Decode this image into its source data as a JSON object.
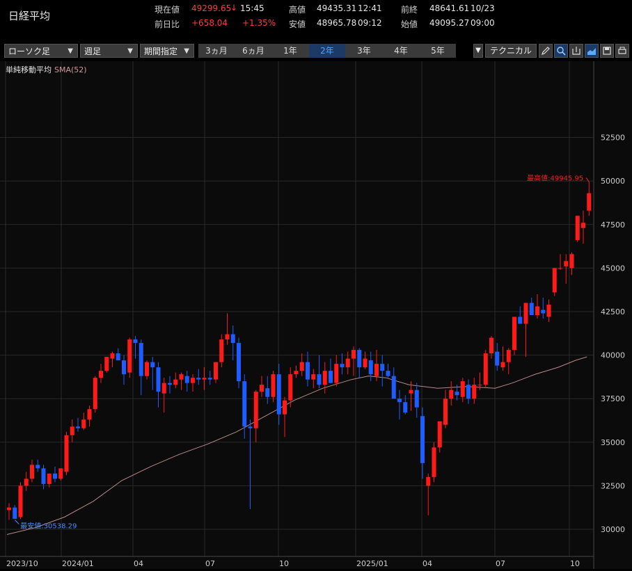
{
  "header": {
    "title": "日経平均",
    "current_label": "現在値",
    "current_value": "49299.65",
    "current_arrow": "↓",
    "current_time": "15:45",
    "change_label": "前日比",
    "change_value": "+658.04",
    "change_pct": "+1.35%",
    "high_label": "高値",
    "high_value": "49435.31",
    "high_time": "12:41",
    "low_label": "安値",
    "low_value": "48965.78",
    "low_time": "09:12",
    "prev_label": "前終",
    "prev_value": "48641.61",
    "prev_date": "10/23",
    "open_label": "始値",
    "open_value": "49095.27",
    "open_time": "09:00"
  },
  "toolbar": {
    "chart_type": "ローソク足",
    "period_type": "週足",
    "range_mode": "期間指定",
    "range_tabs": [
      "3ヵ月",
      "6ヵ月",
      "1年",
      "2年",
      "3年",
      "4年",
      "5年"
    ],
    "selected_tab": "2年",
    "technical_label": "テクニカル",
    "icons": [
      "pencil-icon",
      "zoom-icon",
      "export-icon",
      "chart-area-icon",
      "save-icon",
      "print-icon",
      "list-icon"
    ]
  },
  "legend": {
    "indicator": "単純移動平均",
    "sma": "SMA(52)"
  },
  "colors": {
    "up": "#ff1a1a",
    "down": "#1f5cff",
    "sma": "#d8a0a0",
    "grid": "#2a2a2a",
    "selected_tab_bg": "#1b3a66"
  },
  "chart_data": {
    "type": "candlestick",
    "y_ticks": [
      30000,
      32500,
      35000,
      37500,
      40000,
      42500,
      45000,
      47500,
      50000,
      52500
    ],
    "ylim": [
      29000,
      54000
    ],
    "x_tick_labels": [
      "2023/10",
      "2024/01",
      "04",
      "07",
      "10",
      "2025/01",
      "04",
      "07",
      "10"
    ],
    "annotations": {
      "high": "最高値:49945.95",
      "low": "最安値:30538.29"
    },
    "candles": [
      [
        31100,
        31500,
        30538.29,
        31250
      ],
      [
        31250,
        31400,
        30700,
        30600
      ],
      [
        30700,
        32700,
        30600,
        32500
      ],
      [
        32500,
        33300,
        32200,
        32900
      ],
      [
        32900,
        34000,
        32700,
        33700
      ],
      [
        33700,
        34000,
        33300,
        33500
      ],
      [
        33500,
        33700,
        32300,
        32600
      ],
      [
        32600,
        33200,
        32400,
        33200
      ],
      [
        33200,
        33600,
        32700,
        32900
      ],
      [
        32900,
        33500,
        32800,
        33500
      ],
      [
        33300,
        35600,
        33100,
        35400
      ],
      [
        35400,
        36300,
        35000,
        35900
      ],
      [
        35900,
        36400,
        35600,
        35800
      ],
      [
        35800,
        36700,
        35700,
        36300
      ],
      [
        36300,
        37100,
        35900,
        36900
      ],
      [
        36900,
        38800,
        36700,
        38700
      ],
      [
        38700,
        39500,
        38400,
        39100
      ],
      [
        39100,
        39800,
        39000,
        39900
      ],
      [
        39800,
        40200,
        39300,
        40100
      ],
      [
        40100,
        40400,
        39900,
        39700
      ],
      [
        39700,
        40000,
        38300,
        38900
      ],
      [
        39000,
        41000,
        38700,
        40900
      ],
      [
        40900,
        41100,
        39800,
        40700
      ],
      [
        40700,
        40900,
        37700,
        38800
      ],
      [
        38800,
        39700,
        38600,
        39600
      ],
      [
        39600,
        39900,
        38000,
        39300
      ],
      [
        39300,
        39600,
        37000,
        37900
      ],
      [
        37800,
        38700,
        36700,
        38400
      ],
      [
        38400,
        38800,
        37800,
        38300
      ],
      [
        38300,
        39000,
        38100,
        38600
      ],
      [
        38600,
        39000,
        38000,
        38900
      ],
      [
        38800,
        39100,
        37900,
        38400
      ],
      [
        38400,
        38900,
        37900,
        38700
      ],
      [
        38700,
        39200,
        38300,
        38600
      ],
      [
        38600,
        39300,
        38000,
        38700
      ],
      [
        38700,
        39100,
        38300,
        38600
      ],
      [
        38600,
        39600,
        38400,
        39600
      ],
      [
        39600,
        41200,
        39300,
        40900
      ],
      [
        40900,
        42400,
        40600,
        41200
      ],
      [
        41200,
        41700,
        39700,
        40700
      ],
      [
        40700,
        41000,
        38100,
        38500
      ],
      [
        38500,
        38900,
        35200,
        35900
      ],
      [
        35900,
        36300,
        31156,
        35800
      ],
      [
        35800,
        38000,
        35000,
        37900
      ],
      [
        37900,
        38800,
        37600,
        38300
      ],
      [
        38100,
        38800,
        37200,
        37600
      ],
      [
        37600,
        39100,
        37300,
        38900
      ],
      [
        38900,
        39500,
        36000,
        36600
      ],
      [
        36600,
        37600,
        35300,
        37400
      ],
      [
        37400,
        39300,
        37000,
        38900
      ],
      [
        38900,
        39400,
        38700,
        39100
      ],
      [
        39100,
        40100,
        38800,
        39600
      ],
      [
        39600,
        40200,
        38200,
        38600
      ],
      [
        38600,
        39200,
        38100,
        38900
      ],
      [
        38900,
        40000,
        38100,
        38300
      ],
      [
        38300,
        39600,
        37800,
        39100
      ],
      [
        39100,
        39800,
        38400,
        38400
      ],
      [
        38400,
        40000,
        38200,
        39500
      ],
      [
        39500,
        40100,
        38900,
        39300
      ],
      [
        39300,
        40200,
        38900,
        39800
      ],
      [
        39800,
        40500,
        38800,
        40300
      ],
      [
        40300,
        40400,
        38700,
        39300
      ],
      [
        39300,
        40200,
        39200,
        39800
      ],
      [
        39700,
        40200,
        38500,
        38900
      ],
      [
        38800,
        40300,
        38500,
        39500
      ],
      [
        39500,
        40000,
        38200,
        39100
      ],
      [
        39100,
        39500,
        38700,
        38800
      ],
      [
        38800,
        39300,
        37700,
        37500
      ],
      [
        37500,
        38000,
        36300,
        37300
      ],
      [
        37300,
        37700,
        36600,
        36700
      ],
      [
        37800,
        38500,
        36800,
        38000
      ],
      [
        38000,
        38400,
        36400,
        37000
      ],
      [
        36500,
        37000,
        32900,
        33800
      ],
      [
        32500,
        33200,
        30800,
        33000
      ],
      [
        33000,
        35000,
        32700,
        34700
      ],
      [
        34700,
        36200,
        34400,
        36200
      ],
      [
        36000,
        38000,
        35800,
        37500
      ],
      [
        37500,
        38500,
        37100,
        38000
      ],
      [
        37900,
        38300,
        37400,
        37700
      ],
      [
        37600,
        38700,
        37300,
        38500
      ],
      [
        38300,
        38600,
        37200,
        37500
      ],
      [
        37500,
        38700,
        37200,
        38300
      ],
      [
        38300,
        39000,
        38000,
        38300
      ],
      [
        38300,
        40300,
        38100,
        40100
      ],
      [
        40100,
        41100,
        39800,
        41000
      ],
      [
        40200,
        40700,
        39100,
        39400
      ],
      [
        39300,
        40500,
        39100,
        39600
      ],
      [
        39600,
        40400,
        38900,
        40300
      ],
      [
        40300,
        42100,
        40000,
        42200
      ],
      [
        42200,
        42800,
        41800,
        41800
      ],
      [
        41800,
        43000,
        39900,
        43000
      ],
      [
        43000,
        43300,
        42600,
        42300
      ],
      [
        42300,
        43500,
        42100,
        42800
      ],
      [
        42600,
        43300,
        42100,
        42400
      ],
      [
        42200,
        43200,
        41900,
        42900
      ],
      [
        43600,
        45000,
        43400,
        45000
      ],
      [
        45000,
        45800,
        44900,
        45000
      ],
      [
        45100,
        45800,
        44100,
        45400
      ],
      [
        45000,
        45900,
        44600,
        45800
      ],
      [
        46600,
        48000,
        46500,
        48000
      ],
      [
        47300,
        48300,
        46400,
        47600
      ],
      [
        48300,
        49945.95,
        48000,
        49299.65
      ]
    ],
    "sma_52": [
      [
        0,
        29700
      ],
      [
        5,
        30100
      ],
      [
        10,
        30700
      ],
      [
        15,
        31600
      ],
      [
        20,
        32800
      ],
      [
        25,
        33600
      ],
      [
        30,
        34300
      ],
      [
        35,
        34900
      ],
      [
        40,
        35600
      ],
      [
        45,
        36500
      ],
      [
        50,
        37400
      ],
      [
        55,
        38100
      ],
      [
        60,
        38600
      ],
      [
        63,
        38800
      ],
      [
        66,
        38700
      ],
      [
        70,
        38300
      ],
      [
        75,
        38100
      ],
      [
        80,
        38200
      ],
      [
        85,
        38100
      ],
      [
        88,
        38400
      ],
      [
        92,
        38900
      ],
      [
        96,
        39300
      ],
      [
        99,
        39700
      ],
      [
        101,
        39900
      ]
    ]
  }
}
